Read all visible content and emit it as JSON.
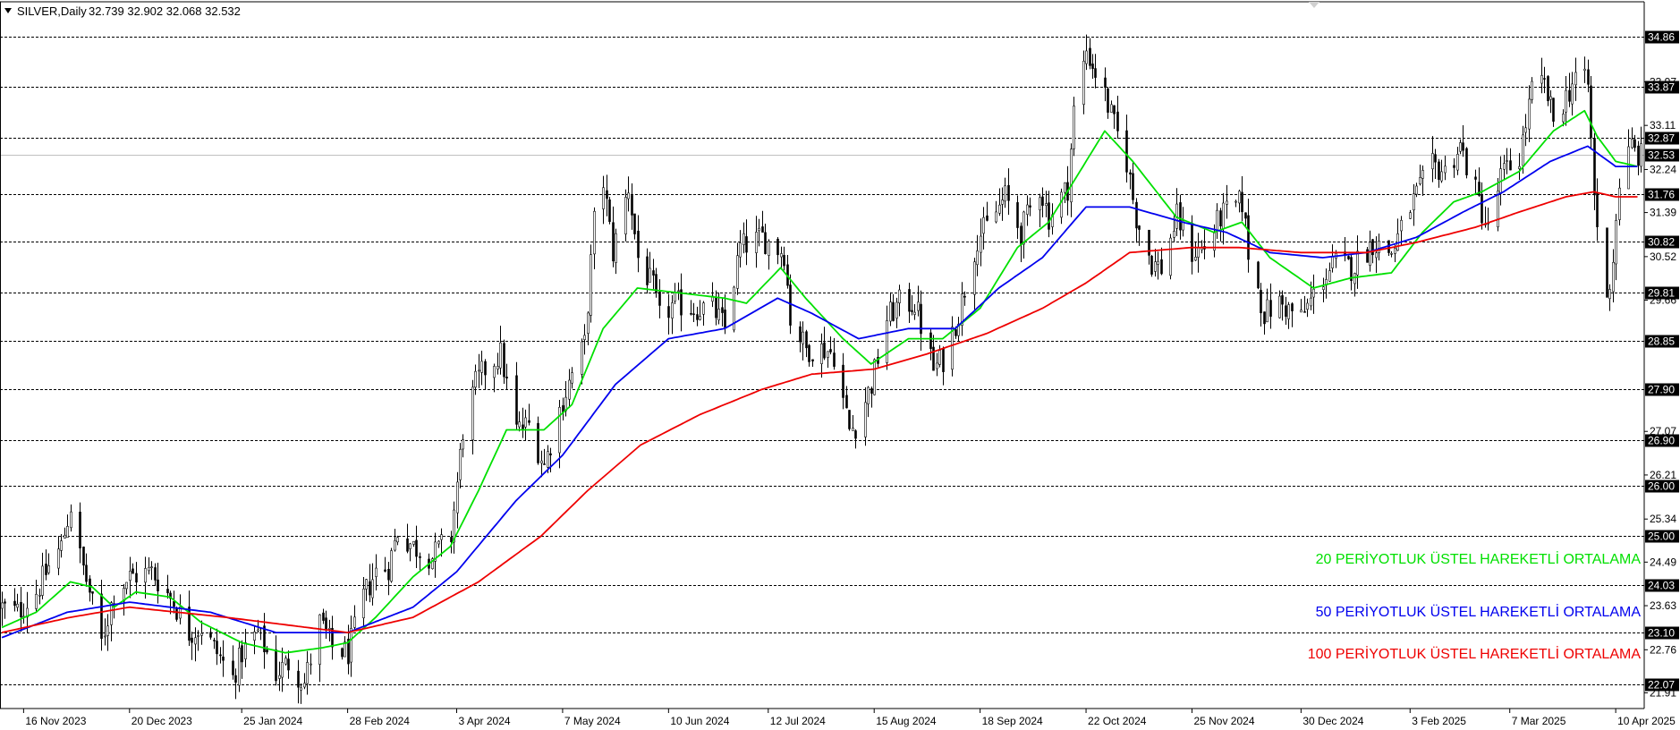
{
  "header": {
    "symbol": "SILVER,Daily",
    "ohlc": "32.739 32.902 32.068 32.532"
  },
  "colors": {
    "ema20": "#00e000",
    "ema50": "#0000ee",
    "ema100": "#ee0000",
    "candle": "#000000",
    "level_line": "#000000",
    "current_price_line": "#c0c0c0"
  },
  "chart_data": {
    "type": "line",
    "title": "",
    "xlabel": "",
    "ylabel": "",
    "ylim": [
      21.6,
      35.55
    ],
    "xlim": [
      "2023-11-09",
      "2025-04-18"
    ],
    "grid": false,
    "x_ticks": [
      {
        "date": "2023-11-16",
        "label": "16 Nov 2023"
      },
      {
        "date": "2023-12-20",
        "label": "20 Dec 2023"
      },
      {
        "date": "2024-01-25",
        "label": "25 Jan 2024"
      },
      {
        "date": "2024-02-28",
        "label": "28 Feb 2024"
      },
      {
        "date": "2024-04-03",
        "label": "3 Apr 2024"
      },
      {
        "date": "2024-05-07",
        "label": "7 May 2024"
      },
      {
        "date": "2024-06-10",
        "label": "10 Jun 2024"
      },
      {
        "date": "2024-07-12",
        "label": "12 Jul 2024"
      },
      {
        "date": "2024-08-15",
        "label": "15 Aug 2024"
      },
      {
        "date": "2024-09-18",
        "label": "18 Sep 2024"
      },
      {
        "date": "2024-10-22",
        "label": "22 Oct 2024"
      },
      {
        "date": "2024-11-25",
        "label": "25 Nov 2024"
      },
      {
        "date": "2024-12-30",
        "label": "30 Dec 2024"
      },
      {
        "date": "2025-02-03",
        "label": "3 Feb 2025"
      },
      {
        "date": "2025-03-07",
        "label": "7 Mar 2025"
      },
      {
        "date": "2025-04-10",
        "label": "10 Apr 2025"
      }
    ],
    "y_ticks": [
      {
        "value": 33.97,
        "label": "33.97"
      },
      {
        "value": 33.11,
        "label": "33.11"
      },
      {
        "value": 32.24,
        "label": "32.24"
      },
      {
        "value": 31.39,
        "label": "31.39"
      },
      {
        "value": 30.52,
        "label": "30.52"
      },
      {
        "value": 29.66,
        "label": "29.66"
      },
      {
        "value": 27.07,
        "label": "27.07"
      },
      {
        "value": 26.21,
        "label": "26.21"
      },
      {
        "value": 25.34,
        "label": "25.34"
      },
      {
        "value": 24.49,
        "label": "24.49"
      },
      {
        "value": 23.63,
        "label": "23.63"
      },
      {
        "value": 22.76,
        "label": "22.76"
      },
      {
        "value": 21.91,
        "label": "21.91"
      }
    ],
    "levels": [
      {
        "value": 34.86,
        "label": "34.86"
      },
      {
        "value": 33.87,
        "label": "33.87"
      },
      {
        "value": 32.87,
        "label": "32.87"
      },
      {
        "value": 31.76,
        "label": "31.76"
      },
      {
        "value": 30.82,
        "label": "30.82"
      },
      {
        "value": 29.81,
        "label": "29.81"
      },
      {
        "value": 28.85,
        "label": "28.85"
      },
      {
        "value": 27.9,
        "label": "27.90"
      },
      {
        "value": 26.9,
        "label": "26.90"
      },
      {
        "value": 26.0,
        "label": "26.00"
      },
      {
        "value": 25.0,
        "label": "25.00"
      },
      {
        "value": 24.03,
        "label": "24.03"
      },
      {
        "value": 23.1,
        "label": "23.10"
      },
      {
        "value": 22.07,
        "label": "22.07"
      }
    ],
    "current_price": {
      "value": 32.53,
      "label": "32.53"
    },
    "price_anchors": [
      [
        "2023-11-09",
        23.6
      ],
      [
        "2023-11-14",
        23.5
      ],
      [
        "2023-11-20",
        23.9
      ],
      [
        "2023-11-24",
        24.4
      ],
      [
        "2023-11-28",
        24.8
      ],
      [
        "2023-12-01",
        25.6
      ],
      [
        "2023-12-04",
        24.6
      ],
      [
        "2023-12-07",
        23.9
      ],
      [
        "2023-12-11",
        22.9
      ],
      [
        "2023-12-15",
        23.9
      ],
      [
        "2023-12-20",
        24.2
      ],
      [
        "2023-12-27",
        24.3
      ],
      [
        "2024-01-03",
        23.7
      ],
      [
        "2024-01-08",
        23.1
      ],
      [
        "2024-01-12",
        23.2
      ],
      [
        "2024-01-18",
        22.6
      ],
      [
        "2024-01-22",
        22.2
      ],
      [
        "2024-01-25",
        22.7
      ],
      [
        "2024-01-30",
        23.1
      ],
      [
        "2024-02-05",
        22.3
      ],
      [
        "2024-02-09",
        22.5
      ],
      [
        "2024-02-14",
        22.1
      ],
      [
        "2024-02-19",
        23.3
      ],
      [
        "2024-02-23",
        22.8
      ],
      [
        "2024-02-28",
        22.7
      ],
      [
        "2024-03-04",
        23.8
      ],
      [
        "2024-03-08",
        24.3
      ],
      [
        "2024-03-12",
        24.4
      ],
      [
        "2024-03-15",
        25.1
      ],
      [
        "2024-03-20",
        24.8
      ],
      [
        "2024-03-26",
        24.6
      ],
      [
        "2024-04-01",
        25.0
      ],
      [
        "2024-04-05",
        27.1
      ],
      [
        "2024-04-09",
        28.0
      ],
      [
        "2024-04-12",
        28.3
      ],
      [
        "2024-04-17",
        28.6
      ],
      [
        "2024-04-22",
        27.1
      ],
      [
        "2024-04-26",
        27.2
      ],
      [
        "2024-05-01",
        26.4
      ],
      [
        "2024-05-06",
        27.5
      ],
      [
        "2024-05-10",
        28.2
      ],
      [
        "2024-05-14",
        28.8
      ],
      [
        "2024-05-17",
        31.2
      ],
      [
        "2024-05-20",
        32.0
      ],
      [
        "2024-05-23",
        30.6
      ],
      [
        "2024-05-28",
        31.9
      ],
      [
        "2024-05-31",
        30.5
      ],
      [
        "2024-06-05",
        29.9
      ],
      [
        "2024-06-07",
        29.3
      ],
      [
        "2024-06-12",
        29.6
      ],
      [
        "2024-06-18",
        29.5
      ],
      [
        "2024-06-24",
        29.5
      ],
      [
        "2024-06-28",
        29.1
      ],
      [
        "2024-07-03",
        30.7
      ],
      [
        "2024-07-10",
        30.9
      ],
      [
        "2024-07-12",
        30.8
      ],
      [
        "2024-07-17",
        30.6
      ],
      [
        "2024-07-19",
        29.3
      ],
      [
        "2024-07-24",
        28.7
      ],
      [
        "2024-07-30",
        28.7
      ],
      [
        "2024-08-02",
        28.6
      ],
      [
        "2024-08-07",
        27.1
      ],
      [
        "2024-08-09",
        27.2
      ],
      [
        "2024-08-14",
        28.0
      ],
      [
        "2024-08-19",
        29.3
      ],
      [
        "2024-08-23",
        29.6
      ],
      [
        "2024-08-28",
        29.6
      ],
      [
        "2024-09-03",
        28.3
      ],
      [
        "2024-09-06",
        28.5
      ],
      [
        "2024-09-11",
        29.4
      ],
      [
        "2024-09-17",
        30.9
      ],
      [
        "2024-09-20",
        31.1
      ],
      [
        "2024-09-26",
        31.7
      ],
      [
        "2024-10-01",
        31.0
      ],
      [
        "2024-10-07",
        31.9
      ],
      [
        "2024-10-10",
        31.3
      ],
      [
        "2024-10-16",
        31.9
      ],
      [
        "2024-10-18",
        33.4
      ],
      [
        "2024-10-22",
        34.6
      ],
      [
        "2024-10-28",
        33.7
      ],
      [
        "2024-10-31",
        33.1
      ],
      [
        "2024-11-04",
        32.4
      ],
      [
        "2024-11-07",
        31.3
      ],
      [
        "2024-11-12",
        30.4
      ],
      [
        "2024-11-15",
        30.3
      ],
      [
        "2024-11-20",
        31.3
      ],
      [
        "2024-11-25",
        30.6
      ],
      [
        "2024-11-29",
        30.7
      ],
      [
        "2024-12-04",
        31.3
      ],
      [
        "2024-12-11",
        31.6
      ],
      [
        "2024-12-13",
        30.6
      ],
      [
        "2024-12-18",
        29.4
      ],
      [
        "2024-12-23",
        29.6
      ],
      [
        "2024-12-30",
        29.3
      ],
      [
        "2025-01-06",
        30.1
      ],
      [
        "2025-01-10",
        30.4
      ],
      [
        "2025-01-15",
        30.3
      ],
      [
        "2025-01-22",
        30.8
      ],
      [
        "2025-01-28",
        30.6
      ],
      [
        "2025-02-03",
        31.5
      ],
      [
        "2025-02-10",
        32.3
      ],
      [
        "2025-02-14",
        32.2
      ],
      [
        "2025-02-19",
        32.7
      ],
      [
        "2025-02-24",
        31.8
      ],
      [
        "2025-02-28",
        31.0
      ],
      [
        "2025-03-04",
        32.1
      ],
      [
        "2025-03-10",
        32.5
      ],
      [
        "2025-03-14",
        33.8
      ],
      [
        "2025-03-18",
        33.9
      ],
      [
        "2025-03-21",
        33.2
      ],
      [
        "2025-03-26",
        33.8
      ],
      [
        "2025-03-28",
        34.1
      ],
      [
        "2025-04-01",
        33.9
      ],
      [
        "2025-04-03",
        31.7
      ],
      [
        "2025-04-07",
        29.6
      ],
      [
        "2025-04-09",
        30.5
      ],
      [
        "2025-04-11",
        32.0
      ],
      [
        "2025-04-15",
        32.7
      ],
      [
        "2025-04-17",
        32.5
      ]
    ],
    "ema_anchors": {
      "ema20": [
        [
          "2023-11-09",
          23.2
        ],
        [
          "2023-11-20",
          23.5
        ],
        [
          "2023-12-01",
          24.1
        ],
        [
          "2023-12-08",
          24.0
        ],
        [
          "2023-12-15",
          23.6
        ],
        [
          "2023-12-22",
          23.9
        ],
        [
          "2024-01-02",
          23.8
        ],
        [
          "2024-01-12",
          23.3
        ],
        [
          "2024-01-25",
          22.9
        ],
        [
          "2024-02-08",
          22.7
        ],
        [
          "2024-02-20",
          22.8
        ],
        [
          "2024-02-28",
          22.9
        ],
        [
          "2024-03-08",
          23.4
        ],
        [
          "2024-03-20",
          24.2
        ],
        [
          "2024-04-01",
          24.8
        ],
        [
          "2024-04-10",
          25.9
        ],
        [
          "2024-04-19",
          27.1
        ],
        [
          "2024-05-01",
          27.1
        ],
        [
          "2024-05-10",
          27.6
        ],
        [
          "2024-05-20",
          29.1
        ],
        [
          "2024-05-31",
          29.9
        ],
        [
          "2024-06-14",
          29.8
        ],
        [
          "2024-06-28",
          29.7
        ],
        [
          "2024-07-05",
          29.6
        ],
        [
          "2024-07-16",
          30.3
        ],
        [
          "2024-07-24",
          29.7
        ],
        [
          "2024-08-05",
          28.9
        ],
        [
          "2024-08-14",
          28.4
        ],
        [
          "2024-08-26",
          28.9
        ],
        [
          "2024-09-06",
          28.9
        ],
        [
          "2024-09-18",
          29.5
        ],
        [
          "2024-09-30",
          30.7
        ],
        [
          "2024-10-10",
          31.2
        ],
        [
          "2024-10-18",
          32.0
        ],
        [
          "2024-10-28",
          33.0
        ],
        [
          "2024-11-06",
          32.4
        ],
        [
          "2024-11-20",
          31.3
        ],
        [
          "2024-12-02",
          31.0
        ],
        [
          "2024-12-11",
          31.2
        ],
        [
          "2024-12-20",
          30.5
        ],
        [
          "2025-01-03",
          29.9
        ],
        [
          "2025-01-15",
          30.1
        ],
        [
          "2025-01-28",
          30.2
        ],
        [
          "2025-02-07",
          31.0
        ],
        [
          "2025-02-17",
          31.6
        ],
        [
          "2025-02-26",
          31.8
        ],
        [
          "2025-03-10",
          32.2
        ],
        [
          "2025-03-21",
          33.0
        ],
        [
          "2025-03-31",
          33.4
        ],
        [
          "2025-04-04",
          32.9
        ],
        [
          "2025-04-10",
          32.4
        ],
        [
          "2025-04-17",
          32.3
        ]
      ],
      "ema50": [
        [
          "2023-11-09",
          23.0
        ],
        [
          "2023-11-30",
          23.5
        ],
        [
          "2023-12-20",
          23.7
        ],
        [
          "2024-01-15",
          23.5
        ],
        [
          "2024-02-05",
          23.1
        ],
        [
          "2024-02-28",
          23.1
        ],
        [
          "2024-03-20",
          23.6
        ],
        [
          "2024-04-03",
          24.3
        ],
        [
          "2024-04-22",
          25.7
        ],
        [
          "2024-05-07",
          26.6
        ],
        [
          "2024-05-24",
          28.0
        ],
        [
          "2024-06-10",
          28.9
        ],
        [
          "2024-06-28",
          29.1
        ],
        [
          "2024-07-15",
          29.7
        ],
        [
          "2024-07-26",
          29.4
        ],
        [
          "2024-08-10",
          28.9
        ],
        [
          "2024-08-26",
          29.1
        ],
        [
          "2024-09-10",
          29.1
        ],
        [
          "2024-09-24",
          29.9
        ],
        [
          "2024-10-08",
          30.5
        ],
        [
          "2024-10-22",
          31.5
        ],
        [
          "2024-11-05",
          31.5
        ],
        [
          "2024-11-22",
          31.2
        ],
        [
          "2024-12-06",
          31.0
        ],
        [
          "2024-12-20",
          30.6
        ],
        [
          "2025-01-06",
          30.5
        ],
        [
          "2025-01-20",
          30.6
        ],
        [
          "2025-02-05",
          30.9
        ],
        [
          "2025-02-20",
          31.4
        ],
        [
          "2025-03-05",
          31.8
        ],
        [
          "2025-03-20",
          32.4
        ],
        [
          "2025-04-01",
          32.7
        ],
        [
          "2025-04-10",
          32.3
        ],
        [
          "2025-04-17",
          32.3
        ]
      ],
      "ema100": [
        [
          "2023-11-09",
          23.1
        ],
        [
          "2023-12-01",
          23.4
        ],
        [
          "2023-12-20",
          23.6
        ],
        [
          "2024-01-20",
          23.4
        ],
        [
          "2024-02-28",
          23.1
        ],
        [
          "2024-03-20",
          23.4
        ],
        [
          "2024-04-10",
          24.1
        ],
        [
          "2024-04-30",
          25.0
        ],
        [
          "2024-05-15",
          25.9
        ],
        [
          "2024-06-01",
          26.8
        ],
        [
          "2024-06-20",
          27.4
        ],
        [
          "2024-07-10",
          27.9
        ],
        [
          "2024-07-26",
          28.2
        ],
        [
          "2024-08-15",
          28.3
        ],
        [
          "2024-09-01",
          28.6
        ],
        [
          "2024-09-20",
          29.0
        ],
        [
          "2024-10-08",
          29.5
        ],
        [
          "2024-10-22",
          30.0
        ],
        [
          "2024-11-05",
          30.6
        ],
        [
          "2024-11-25",
          30.7
        ],
        [
          "2024-12-10",
          30.7
        ],
        [
          "2024-12-30",
          30.6
        ],
        [
          "2025-01-20",
          30.6
        ],
        [
          "2025-02-05",
          30.8
        ],
        [
          "2025-02-24",
          31.1
        ],
        [
          "2025-03-10",
          31.4
        ],
        [
          "2025-03-25",
          31.7
        ],
        [
          "2025-04-03",
          31.8
        ],
        [
          "2025-04-10",
          31.7
        ],
        [
          "2025-04-17",
          31.7
        ]
      ]
    },
    "series": [
      {
        "key": "ema20",
        "name": "20 PERİYOTLUK ÜSTEL HAREKETLİ ORTALAMA"
      },
      {
        "key": "ema50",
        "name": "50 PERİYOTLUK ÜSTEL HAREKETLİ ORTALAMA"
      },
      {
        "key": "ema100",
        "name": "100 PERİYOTLUK ÜSTEL HAREKETLİ ORTALAMA"
      }
    ]
  }
}
